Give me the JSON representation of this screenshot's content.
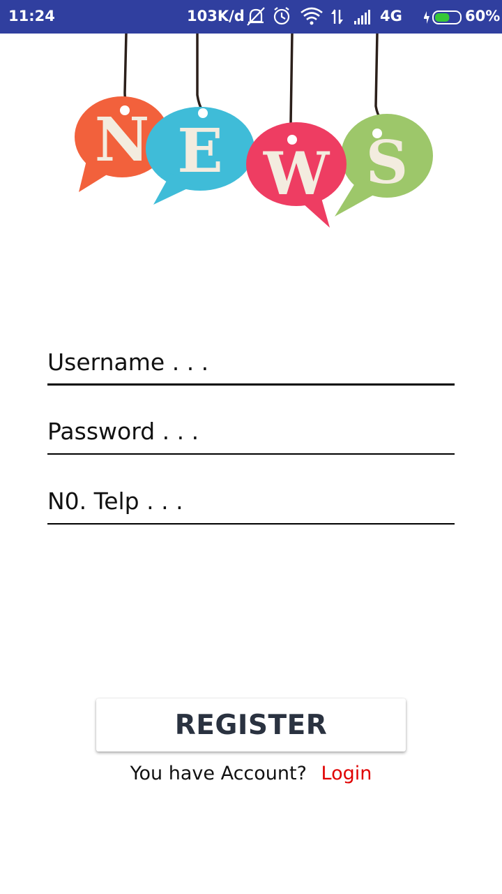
{
  "status_bar": {
    "time": "11:24",
    "speed": "103K/d",
    "network": "4G",
    "battery": "60%",
    "battery_level": 0.6
  },
  "logo": {
    "letters": [
      "N",
      "E",
      "W",
      "S"
    ],
    "colors": [
      "#f2613c",
      "#3fbcd8",
      "#ee3d62",
      "#9dc76a"
    ]
  },
  "form": {
    "username_placeholder": "Username . . .",
    "password_placeholder": "Password . . .",
    "phone_placeholder": "N0. Telp . . ."
  },
  "register_label": "REGISTER",
  "footer": {
    "prompt": "You have Account?",
    "login_link": "Login"
  },
  "accent_color": "#e00000"
}
